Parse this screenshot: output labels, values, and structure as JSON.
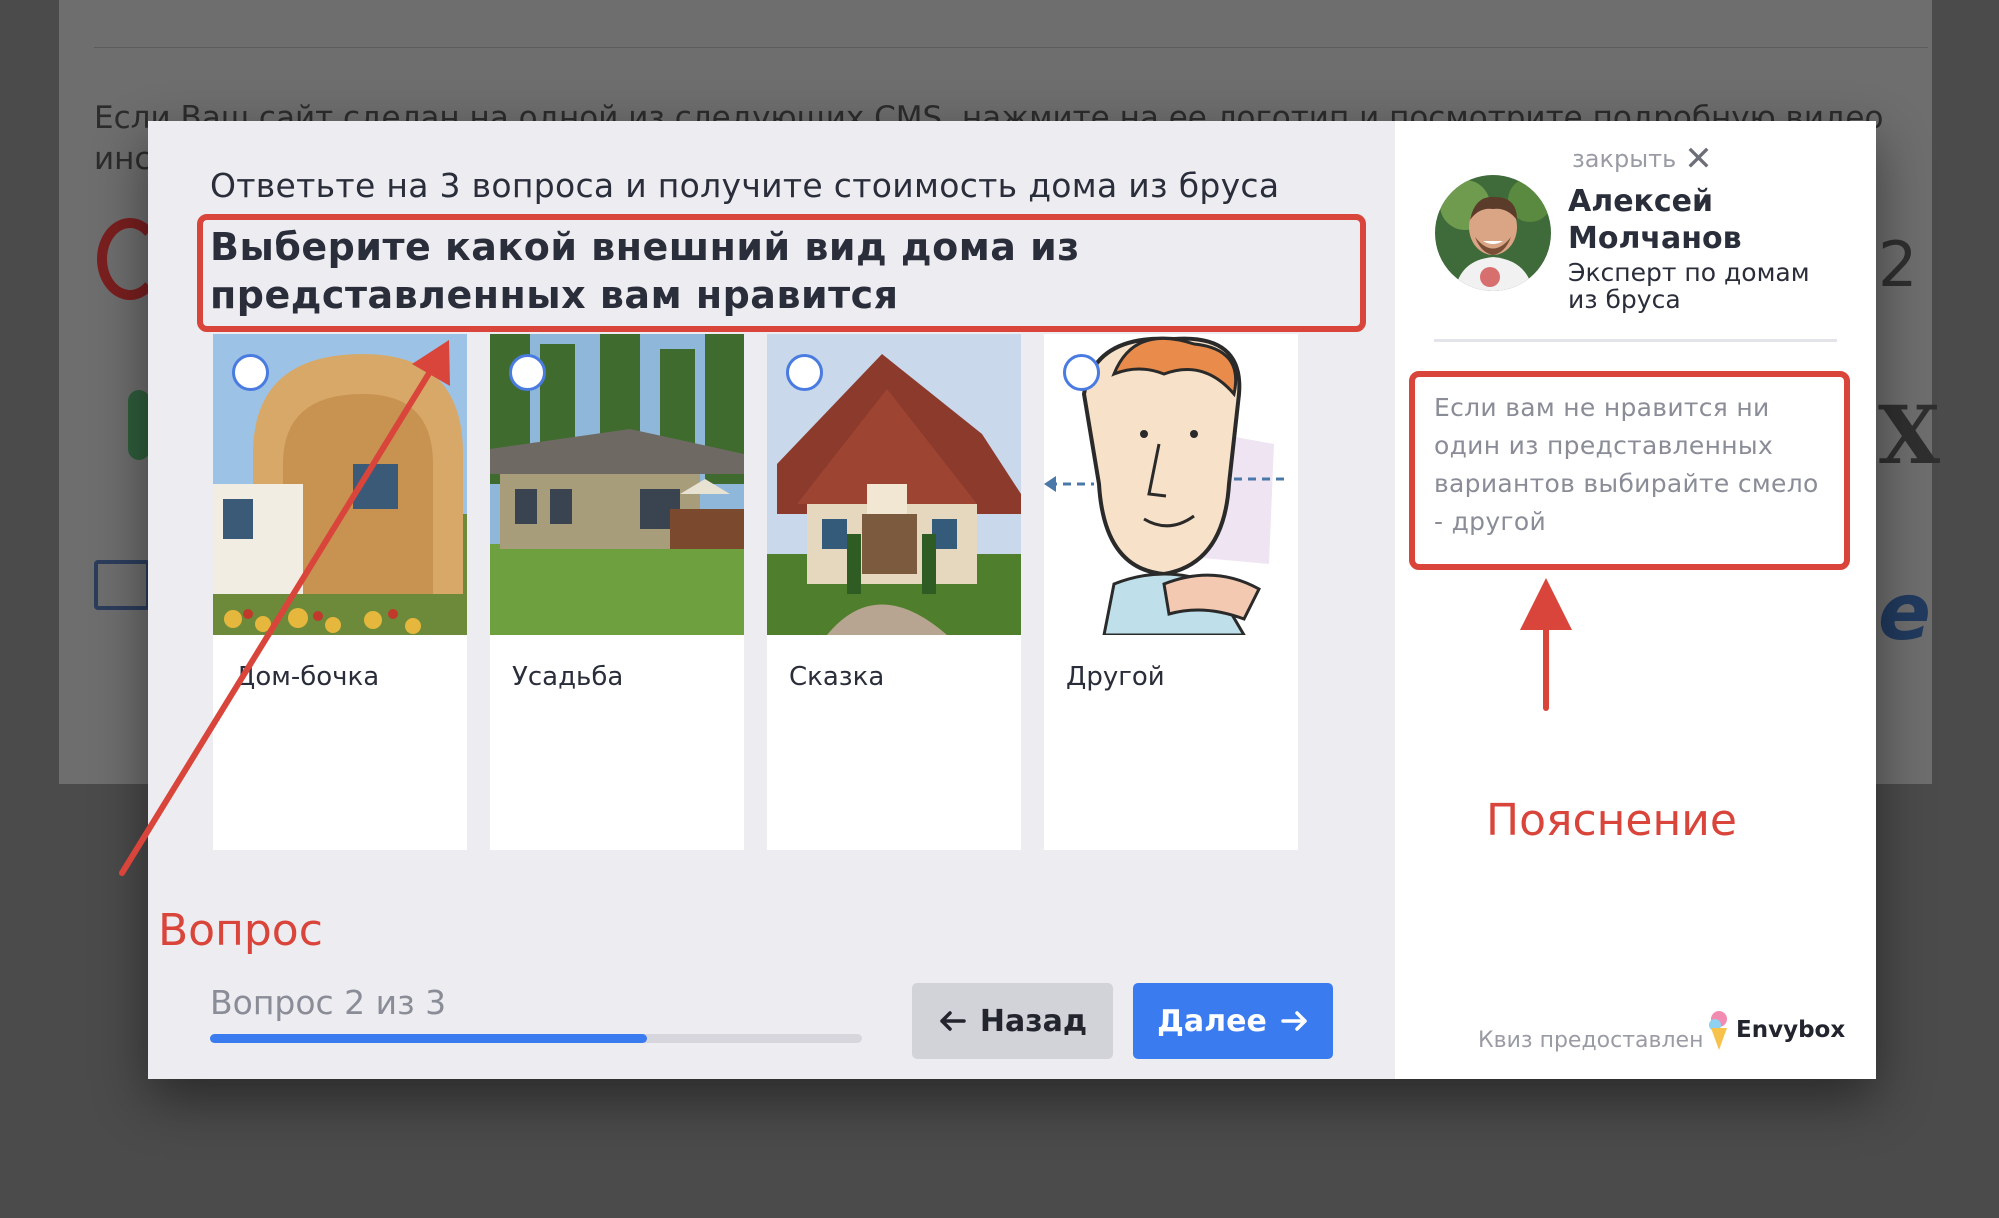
{
  "background_page": {
    "instruction_text": "Если Ваш сайт сделан на одной из следующих CMS, нажмите на ее логотип и посмотрите подробную видео инструкцию об у",
    "logo_glyph_2": "2",
    "logo_glyph_x": "X",
    "logo_glyph_e": "e"
  },
  "quiz": {
    "lead": "Ответьте на 3 вопроса и получите стоимость дома из бруса",
    "question": "Выберите какой внешний вид дома из представленных вам нравится",
    "options": [
      {
        "label": "Дом-бочка",
        "icon": "barrel-house-image"
      },
      {
        "label": "Усадьба",
        "icon": "manor-house-image"
      },
      {
        "label": "Сказка",
        "icon": "fairytale-house-image"
      },
      {
        "label": "Другой",
        "icon": "cartoon-man-image"
      }
    ],
    "progress": {
      "label": "Вопрос 2 из 3",
      "fraction": 0.67
    },
    "back_label": "Назад",
    "next_label": "Далее"
  },
  "sidebar": {
    "close_label": "закрыть",
    "expert_name": "Алексей Молчанов",
    "expert_role": "Эксперт по домам из бруса",
    "hint": "Если вам не нравится ни один из представленных вариантов выбирайте смело - другой",
    "provided_by": "Квиз предоставлен",
    "brand": "Envybox"
  },
  "annotations": {
    "question_label": "Вопрос",
    "hint_label": "Пояснение"
  },
  "colors": {
    "accent": "#3b7bf0",
    "annotation": "#d9453a",
    "modal_left_bg": "#ededf1"
  }
}
